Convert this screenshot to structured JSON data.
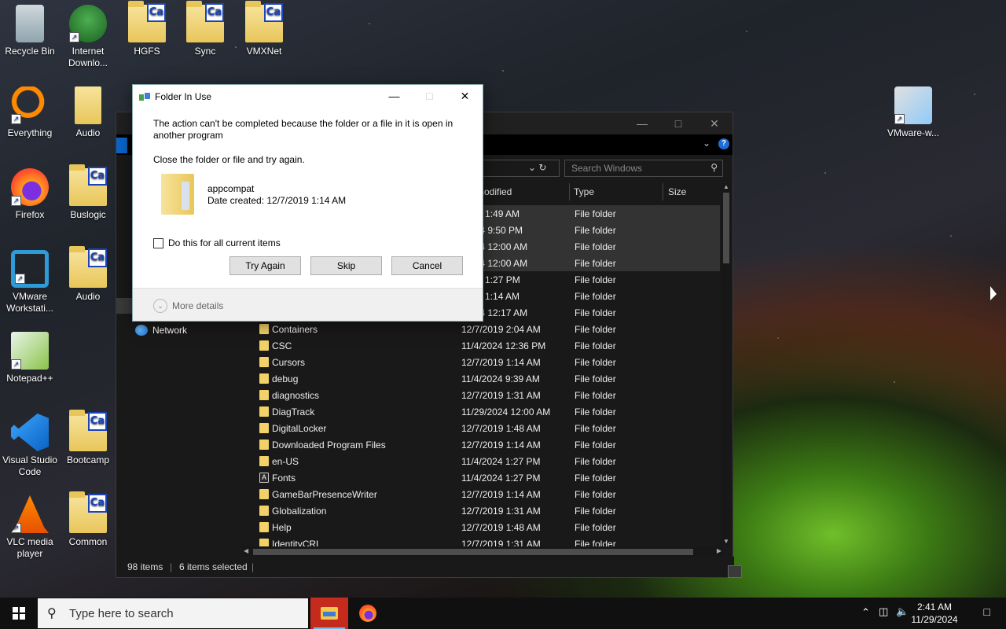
{
  "desktop": {
    "icons": [
      {
        "label": "Recycle Bin",
        "kind": "recycle"
      },
      {
        "label": "Internet Downlo...",
        "kind": "idm"
      },
      {
        "label": "HGFS",
        "kind": "ca"
      },
      {
        "label": "Sync",
        "kind": "ca"
      },
      {
        "label": "VMXNet",
        "kind": "ca"
      },
      {
        "label": "Everything",
        "kind": "everything"
      },
      {
        "label": "Audio",
        "kind": "audio-folder"
      },
      {
        "label": "Firefox",
        "kind": "firefox"
      },
      {
        "label": "Buslogic",
        "kind": "ca"
      },
      {
        "label": "VMware Workstati...",
        "kind": "vmware"
      },
      {
        "label": "Audio",
        "kind": "ca"
      },
      {
        "label": "Notepad++",
        "kind": "notepad"
      },
      {
        "label": "Visual Studio Code",
        "kind": "vscode"
      },
      {
        "label": "Bootcamp",
        "kind": "ca"
      },
      {
        "label": "VLC media player",
        "kind": "vlc"
      },
      {
        "label": "Common",
        "kind": "ca"
      },
      {
        "label": "VMware-w...",
        "kind": "installer"
      }
    ],
    "badge_text": "Ca"
  },
  "explorer": {
    "search_placeholder": "Search Windows",
    "columns": {
      "modified": "modified",
      "type": "Type",
      "size": "Size"
    },
    "nav_network": "Network",
    "rows": [
      {
        "name": "",
        "date": "2019 1:49 AM",
        "type": "File folder",
        "selected": true
      },
      {
        "name": "",
        "date": "/2024 9:50 PM",
        "type": "File folder",
        "selected": true
      },
      {
        "name": "",
        "date": "/2024 12:00 AM",
        "type": "File folder",
        "selected": true
      },
      {
        "name": "",
        "date": "/2024 12:00 AM",
        "type": "File folder",
        "selected": true
      },
      {
        "name": "",
        "date": "2024 1:27 PM",
        "type": "File folder",
        "selected": false
      },
      {
        "name": "",
        "date": "2019 1:14 AM",
        "type": "File folder",
        "selected": false
      },
      {
        "name": "",
        "date": "/2024 12:17 AM",
        "type": "File folder",
        "selected": false
      },
      {
        "name": "Containers",
        "date": "12/7/2019 2:04 AM",
        "type": "File folder",
        "selected": false
      },
      {
        "name": "CSC",
        "date": "11/4/2024 12:36 PM",
        "type": "File folder",
        "selected": false
      },
      {
        "name": "Cursors",
        "date": "12/7/2019 1:14 AM",
        "type": "File folder",
        "selected": false
      },
      {
        "name": "debug",
        "date": "11/4/2024 9:39 AM",
        "type": "File folder",
        "selected": false
      },
      {
        "name": "diagnostics",
        "date": "12/7/2019 1:31 AM",
        "type": "File folder",
        "selected": false
      },
      {
        "name": "DiagTrack",
        "date": "11/29/2024 12:00 AM",
        "type": "File folder",
        "selected": false
      },
      {
        "name": "DigitalLocker",
        "date": "12/7/2019 1:48 AM",
        "type": "File folder",
        "selected": false
      },
      {
        "name": "Downloaded Program Files",
        "date": "12/7/2019 1:14 AM",
        "type": "File folder",
        "selected": false
      },
      {
        "name": "en-US",
        "date": "11/4/2024 1:27 PM",
        "type": "File folder",
        "selected": false
      },
      {
        "name": "Fonts",
        "date": "11/4/2024 1:27 PM",
        "type": "File folder",
        "selected": false,
        "fonts": true
      },
      {
        "name": "GameBarPresenceWriter",
        "date": "12/7/2019 1:14 AM",
        "type": "File folder",
        "selected": false
      },
      {
        "name": "Globalization",
        "date": "12/7/2019 1:31 AM",
        "type": "File folder",
        "selected": false
      },
      {
        "name": "Help",
        "date": "12/7/2019 1:48 AM",
        "type": "File folder",
        "selected": false
      },
      {
        "name": "IdentityCRL",
        "date": "12/7/2019 1:31 AM",
        "type": "File folder",
        "selected": false
      }
    ],
    "status_items": "98 items",
    "status_selected": "6 items selected"
  },
  "dialog": {
    "title": "Folder In Use",
    "message": "The action can't be completed because the folder or a file in it is open in another program",
    "instruction": "Close the folder or file and try again.",
    "file_name": "appcompat",
    "file_date": "Date created: 12/7/2019 1:14 AM",
    "checkbox_label": "Do this for all current items",
    "btn_try_again": "Try Again",
    "btn_skip": "Skip",
    "btn_cancel": "Cancel",
    "more_details": "More details"
  },
  "taskbar": {
    "search_placeholder": "Type here to search",
    "time": "2:41 AM",
    "date": "11/29/2024"
  }
}
